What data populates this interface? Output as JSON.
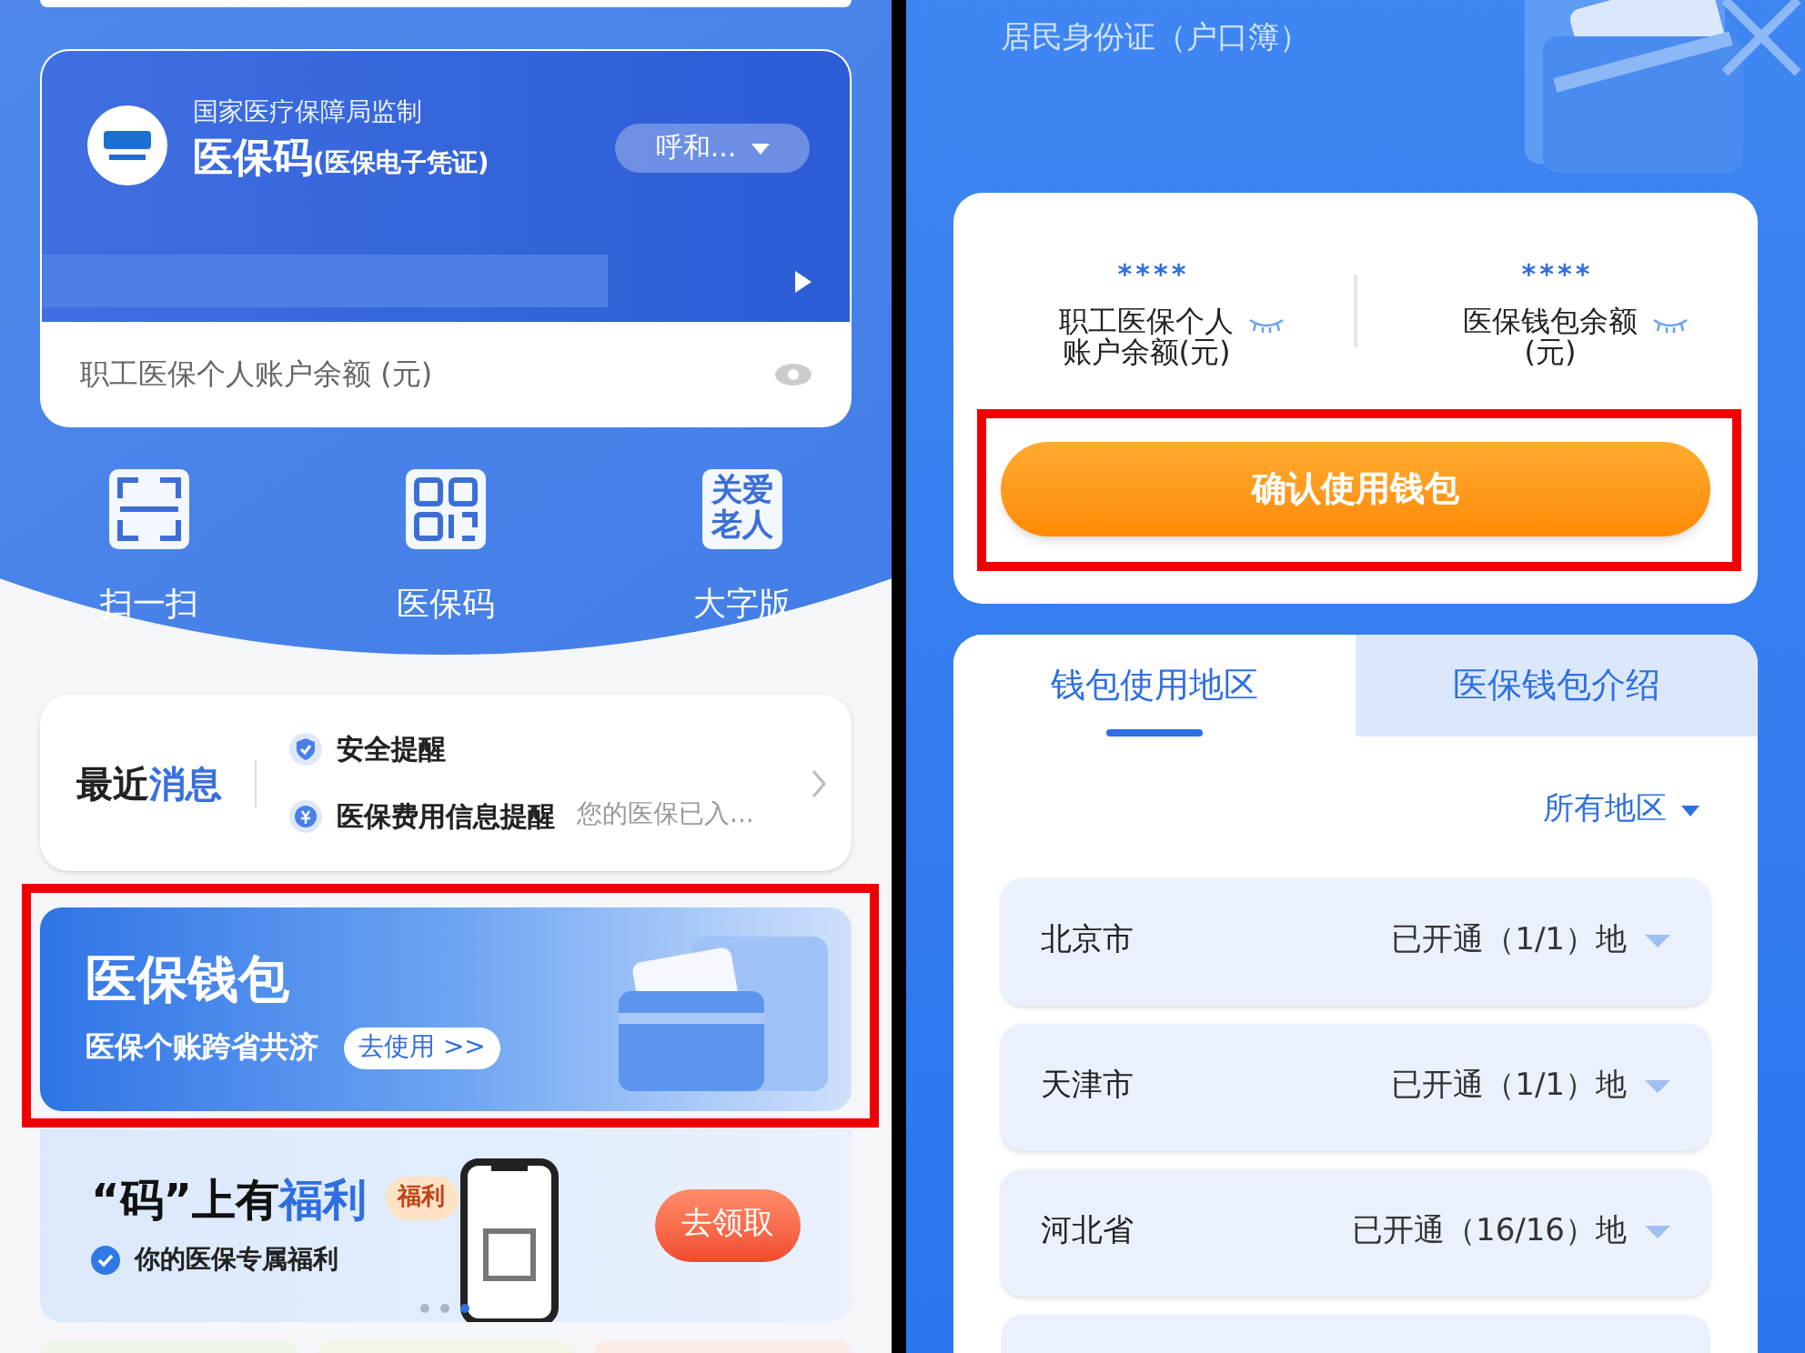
{
  "left_screen": {
    "code_card": {
      "supervisor": "国家医疗保障局监制",
      "title": "医保码",
      "subtitle": "(医保电子凭证)",
      "region": "呼和...",
      "balance_label": "职工医保个人账户余额 (元)"
    },
    "shortcuts": [
      {
        "kind": "scan",
        "label": "扫一扫"
      },
      {
        "kind": "qr",
        "label": "医保码"
      },
      {
        "kind": "elder",
        "label": "大字版",
        "icon_text": "关爱老人"
      }
    ],
    "messages": {
      "title_plain": "最近",
      "title_accent": "消息",
      "items": [
        {
          "kind": "shield",
          "title": "安全提醒"
        },
        {
          "kind": "coin",
          "title": "医保费用信息提醒",
          "preview": "您的医保已入..."
        }
      ]
    },
    "wallet_banner": {
      "title": "医保钱包",
      "subtitle": "医保个账跨省共济",
      "action": "去使用 >>",
      "highlighted": true
    },
    "welfare_banner": {
      "title_plain": "“码”上有",
      "title_accent": "福利",
      "subtitle": "你的医保专属福利",
      "tag": "福利",
      "action": "去领取",
      "dots": [
        {
          "selected": false
        },
        {
          "selected": false
        },
        {
          "selected": true
        }
      ]
    }
  },
  "right_screen": {
    "id_label": "居民身份证（户口簿）",
    "balances": [
      {
        "value": "****",
        "label": "职工医保个人账户余额(元)"
      },
      {
        "value": "****",
        "label": "医保钱包余额(元)"
      }
    ],
    "confirm_button": {
      "label": "确认使用钱包",
      "highlighted": true
    },
    "tabs": [
      {
        "label": "钱包使用地区",
        "selected": true
      },
      {
        "label": "医保钱包介绍",
        "selected": false
      }
    ],
    "region_filter": "所有地区",
    "regions": [
      {
        "name": "北京市",
        "status": "已开通（1/1）地"
      },
      {
        "name": "天津市",
        "status": "已开通（1/1）地"
      },
      {
        "name": "河北省",
        "status": "已开通（16/16）地"
      }
    ]
  }
}
